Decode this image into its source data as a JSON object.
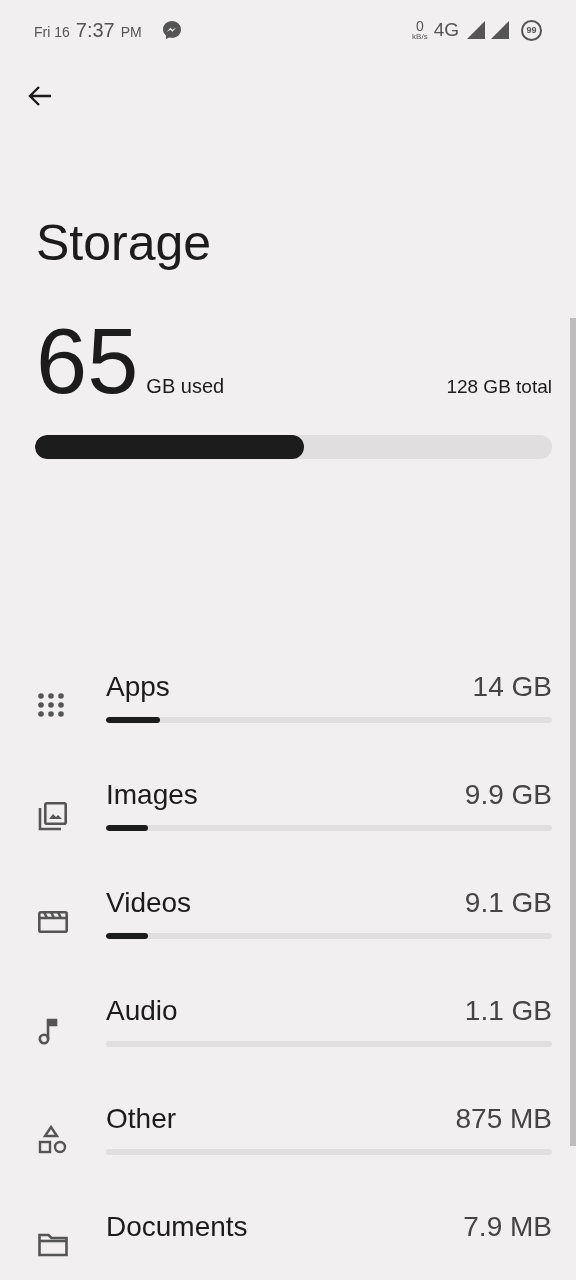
{
  "status_bar": {
    "date": "Fri 16",
    "time": "7:37",
    "meridiem": "PM",
    "speed": "0",
    "speed_unit": "kB/s",
    "network": "4G",
    "battery": "99"
  },
  "title": "Storage",
  "summary": {
    "used": "65",
    "used_unit": "GB used",
    "total": "128 GB total",
    "level": 0.52
  },
  "categories": [
    {
      "kind": "apps",
      "label": "Apps",
      "size": "14 GB",
      "level": 0.12
    },
    {
      "kind": "images",
      "label": "Images",
      "size": "9.9 GB",
      "level": 0.095
    },
    {
      "kind": "videos",
      "label": "Videos",
      "size": "9.1 GB",
      "level": 0.095
    },
    {
      "kind": "audio",
      "label": "Audio",
      "size": "1.1 GB",
      "level": 0
    },
    {
      "kind": "other",
      "label": "Other",
      "size": "875 MB",
      "level": 0
    },
    {
      "kind": "documents",
      "label": "Documents",
      "size": "7.9 MB"
    }
  ]
}
